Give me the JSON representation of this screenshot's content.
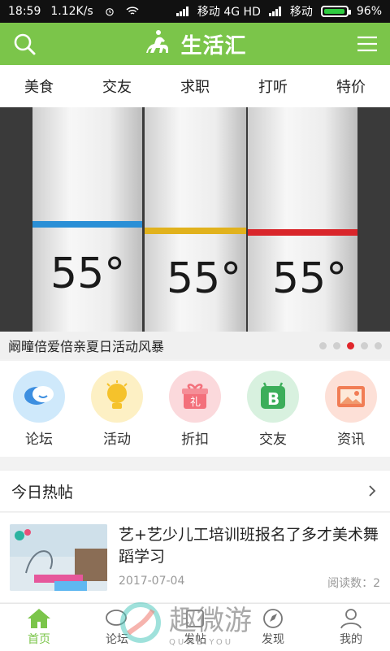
{
  "status": {
    "time": "18:59",
    "speed": "1.12K/s",
    "carrier1": "移动 4G HD",
    "carrier2": "移动",
    "battery": "96%",
    "battery_level": 0.96
  },
  "header": {
    "title": "生活汇",
    "icons": {
      "search": "search-icon",
      "menu": "menu-icon",
      "logo": "horse-rider-icon"
    }
  },
  "categories": [
    "美食",
    "交友",
    "求职",
    "打听",
    "特价"
  ],
  "banner": {
    "caption": "阚疃倍爱倍亲夏日活动风暴",
    "tube_labels": [
      "55°",
      "55°",
      "55°"
    ],
    "dots": 5,
    "active_dot": 3,
    "tube_ring_colors": [
      "#2a8fd6",
      "#e1b21d",
      "#d9262b"
    ]
  },
  "features": [
    {
      "label": "论坛",
      "icon": "chat-bubble-icon",
      "color": "#cfe9fb"
    },
    {
      "label": "活动",
      "icon": "lightbulb-icon",
      "color": "#fdf0c4"
    },
    {
      "label": "折扣",
      "icon": "gift-icon",
      "color": "#fbd9dc"
    },
    {
      "label": "交友",
      "icon": "friend-b-icon",
      "color": "#d8f1df"
    },
    {
      "label": "资讯",
      "icon": "picture-icon",
      "color": "#fde0d7"
    }
  ],
  "hot": {
    "title": "今日热帖",
    "post": {
      "title": "艺+艺少儿工培训班报名了多才美术舞蹈学习",
      "date": "2017-07-04",
      "reads": "阅读数：2"
    }
  },
  "nav": [
    {
      "label": "首页",
      "icon": "home-icon",
      "active": true
    },
    {
      "label": "论坛",
      "icon": "forum-icon",
      "active": false
    },
    {
      "label": "发帖",
      "icon": "post-icon",
      "active": false
    },
    {
      "label": "发现",
      "icon": "discover-icon",
      "active": false
    },
    {
      "label": "我的",
      "icon": "profile-icon",
      "active": false
    }
  ],
  "watermark": {
    "text": "趣微游",
    "sub": "QUWEIYOU"
  },
  "colors": {
    "brand": "#7bc54a",
    "active_dot": "#e0262b"
  }
}
